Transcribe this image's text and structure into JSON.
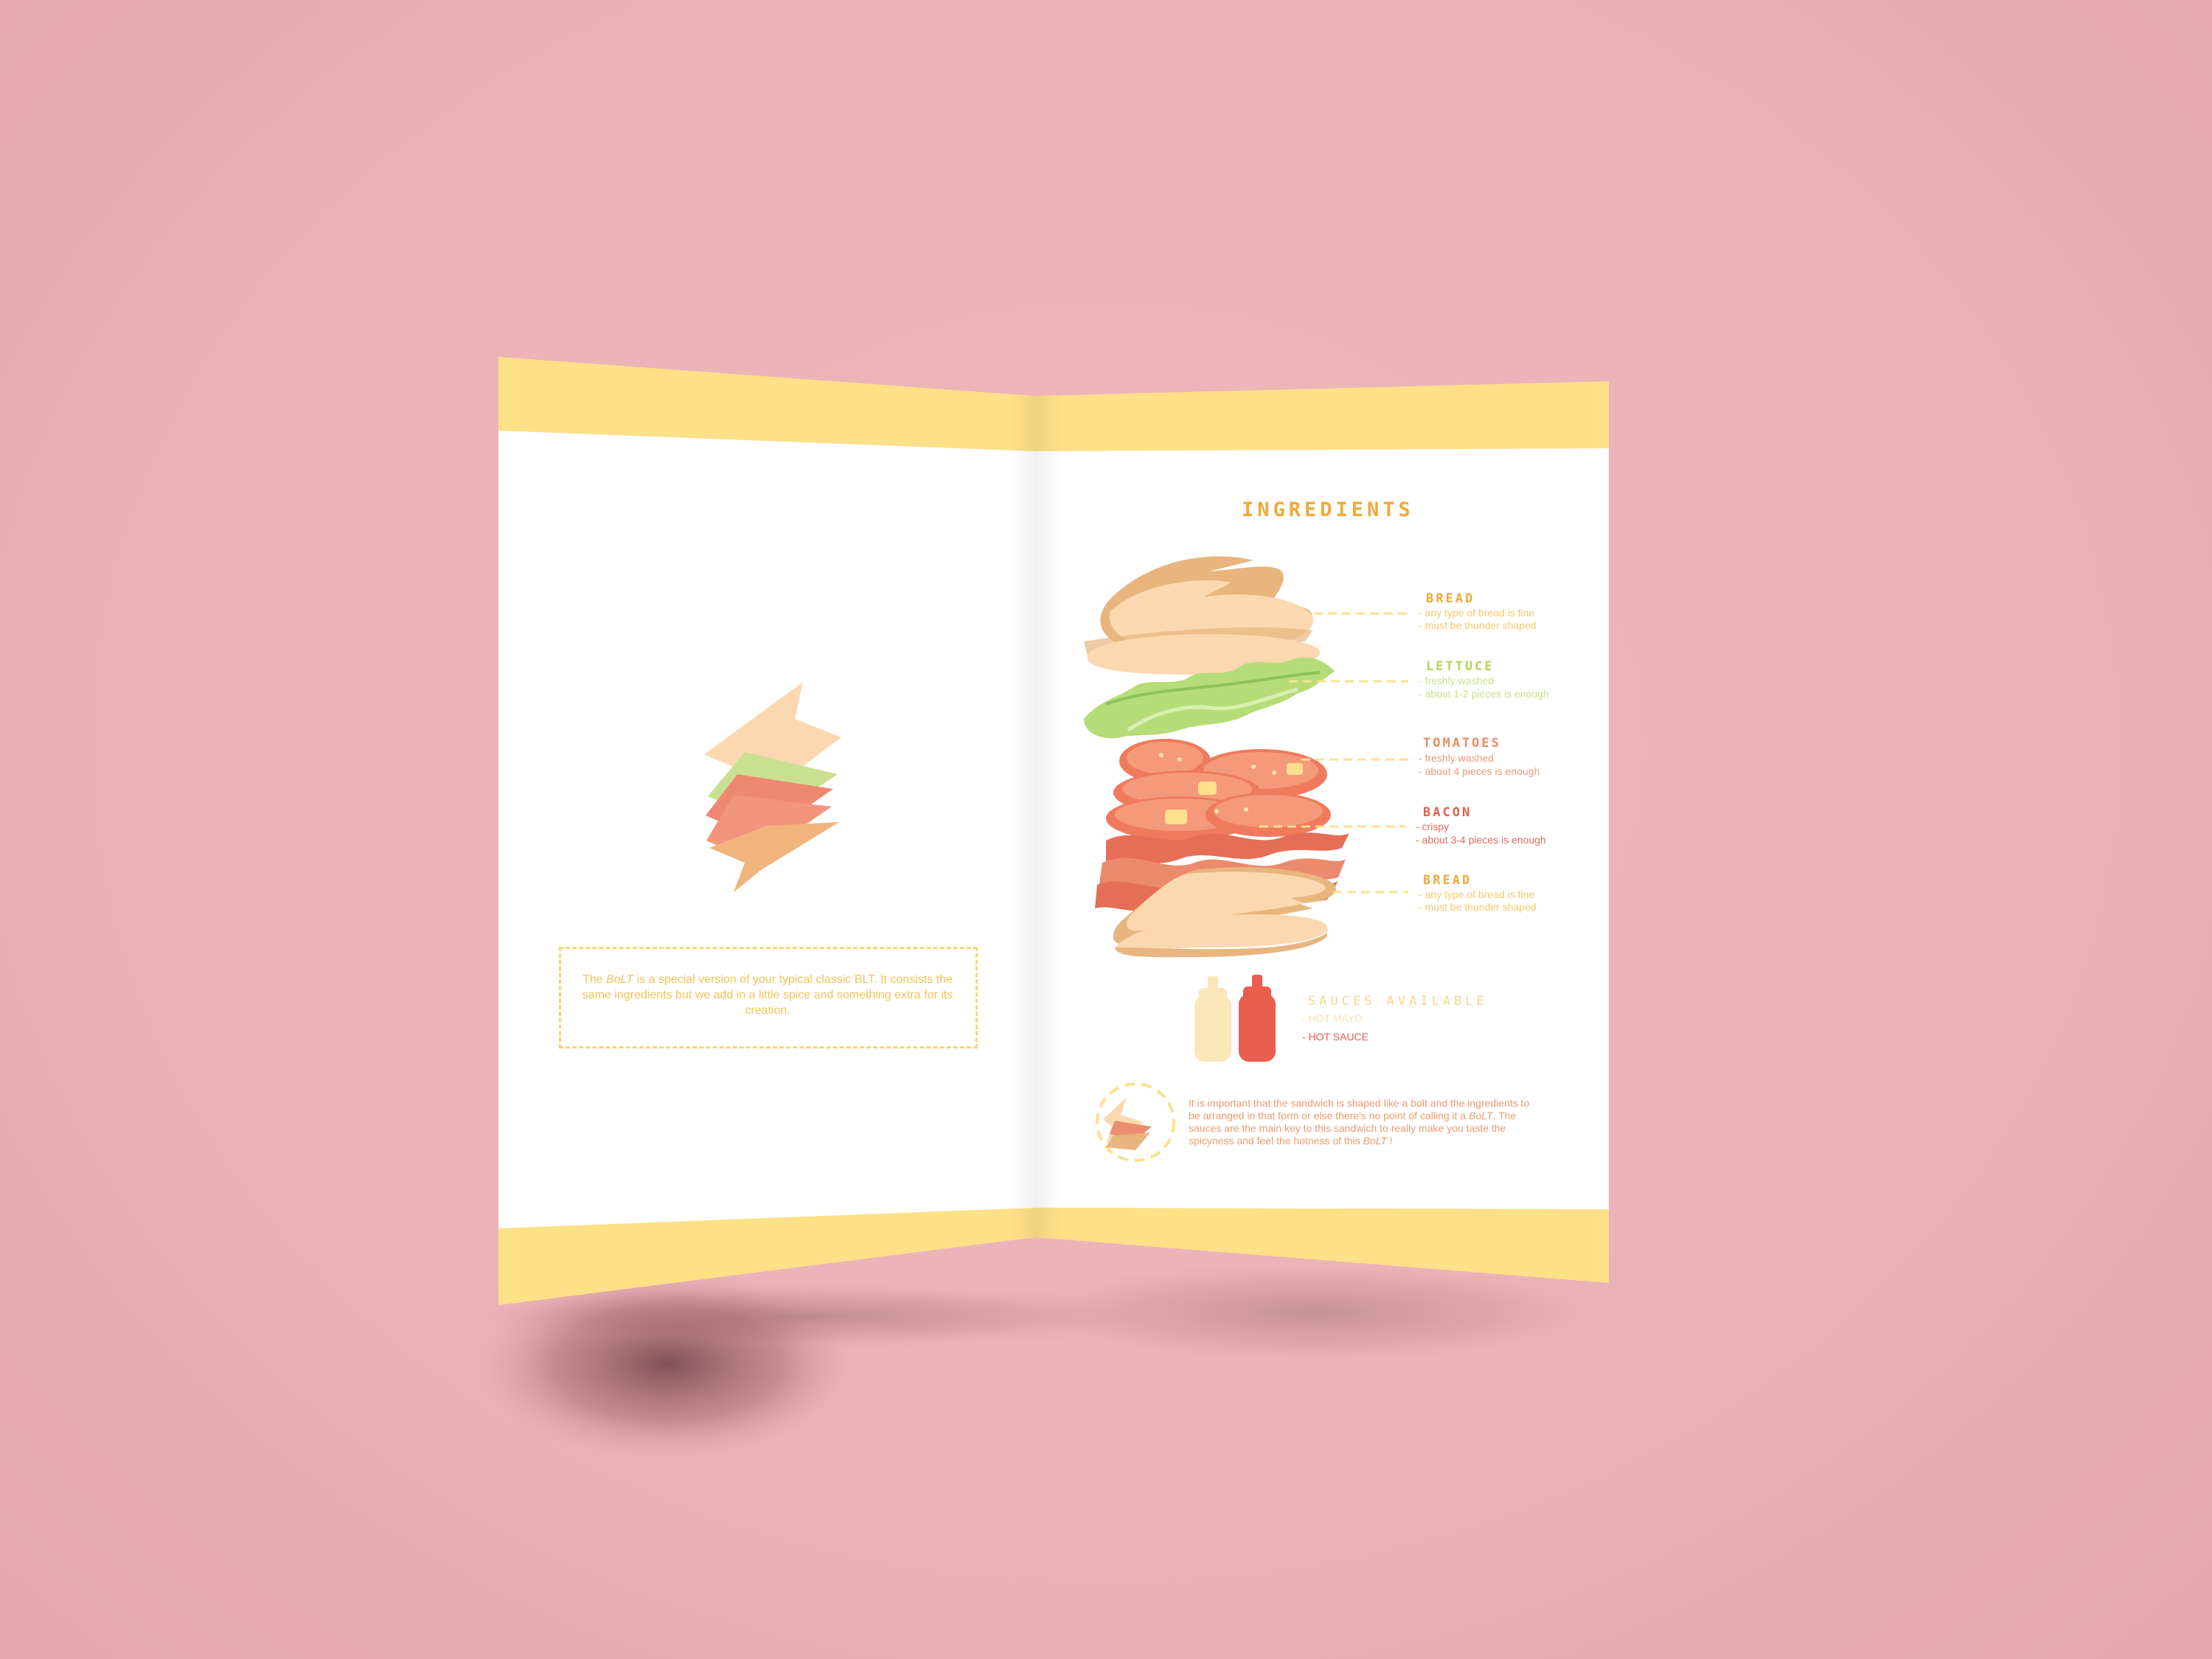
{
  "colors": {
    "background": "#ebb2b8",
    "band_yellow": "#fee088",
    "paper": "#ffffff",
    "bread": "#fbd8b0",
    "bread_edge": "#e7b57d",
    "lettuce": "#b6dc77",
    "tomato": "#ef7a5c",
    "bacon": "#e56e56",
    "heading_orange": "#eeaa39",
    "mayo": "#fbe6b8",
    "hot_sauce": "#ea5e4f"
  },
  "left_page": {
    "intro": {
      "before": "The ",
      "brand": "BoLT",
      "after": " is a special version of your typical classic BLT. It consists the same ingredients but we add in a little spice and something extra for its creation."
    }
  },
  "right_page": {
    "title": "INGREDIENTS",
    "ingredients": [
      {
        "name": "BREAD",
        "lines": [
          "- any type of bread is fine",
          "- must be thunder shaped"
        ]
      },
      {
        "name": "LETTUCE",
        "lines": [
          "- freshly washed",
          "- about 1-2 pieces is enough"
        ]
      },
      {
        "name": "TOMATOES",
        "lines": [
          "- freshly washed",
          "- about 4 pieces is enough"
        ]
      },
      {
        "name": "BACON",
        "lines": [
          "- crispy",
          "- about 3-4 pieces is enough"
        ]
      },
      {
        "name": "BREAD",
        "lines": [
          "- any type of bread is fine",
          "- must be thunder shaped"
        ]
      }
    ],
    "sauces": {
      "title": "SAUCES AVAILABLE",
      "items": [
        "- HOT MAYO",
        "- HOT SAUCE"
      ]
    },
    "footer_note": {
      "p1": "It is important that the sandwich is shaped like a bolt and the ingredients to be arranged in that form or else there's no point of calling it a ",
      "brand1": "BoLT",
      "p2": ". The sauces are the main key to this sandwich to really make you taste the spicyness and feel the hotness of this ",
      "brand2": "BoLT",
      "p3": " !"
    }
  }
}
